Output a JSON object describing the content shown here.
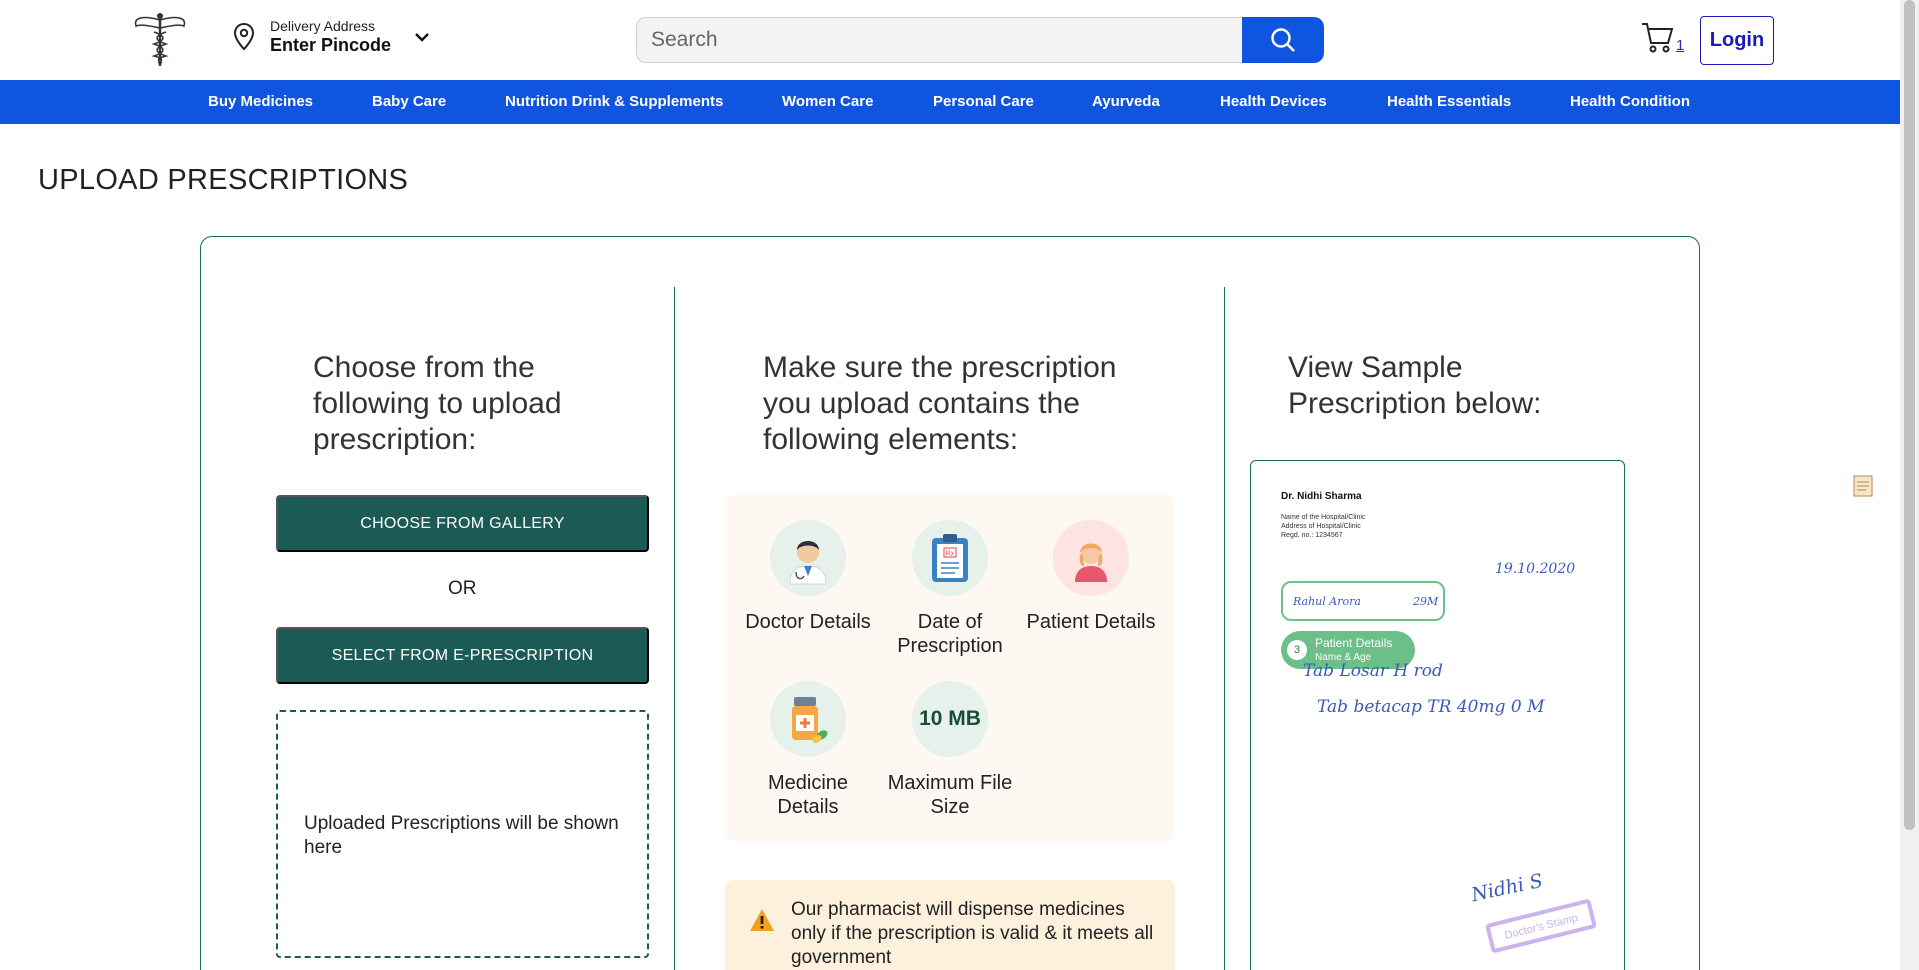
{
  "header": {
    "address_label": "Delivery Address",
    "address_value": "Enter Pincode",
    "search_placeholder": "Search",
    "cart_count": "1",
    "login_label": "Login"
  },
  "nav": {
    "items": [
      "Buy Medicines",
      "Baby Care",
      "Nutrition Drink & Supplements",
      "Women Care",
      "Personal Care",
      "Ayurveda",
      "Health Devices",
      "Health Essentials",
      "Health Condition"
    ]
  },
  "page": {
    "title": "UPLOAD PRESCRIPTIONS"
  },
  "upload": {
    "heading": "Choose from the following to upload prescription:",
    "gallery_button": "CHOOSE FROM GALLERY",
    "or_text": "OR",
    "eprescription_button": "SELECT FROM E-PRESCRIPTION",
    "dropzone_text": "Uploaded Prescriptions will be shown here"
  },
  "requirements": {
    "heading": "Make sure the prescription you upload contains the following elements:",
    "items": [
      {
        "label": "Doctor Details",
        "icon": "doctor-icon"
      },
      {
        "label": "Date of Prescription",
        "icon": "clipboard-rx-icon"
      },
      {
        "label": "Patient Details",
        "icon": "patient-icon"
      },
      {
        "label": "Medicine Details",
        "icon": "medicine-icon"
      },
      {
        "label": "Maximum File Size",
        "badge": "10 MB"
      }
    ],
    "warning": "Our pharmacist will dispense medicines only if the prescription is valid & it meets all government"
  },
  "sample": {
    "heading": "View Sample Prescription below:",
    "doctor_name": "Dr. Nidhi Sharma",
    "hospital_name": "Name of the Hospital/Clinic",
    "hospital_address": "Address of Hospital/Clinic",
    "reg_no": "Regd. no.: 1234567",
    "date_handwritten": "19.10.2020",
    "patient_handwritten": "Rahul Arora",
    "age_handwritten": "29M",
    "rx_line1": "Tab Losar H rod",
    "rx_line2": "Tab betacap TR 40mg 0 M",
    "tag_number": "3",
    "tag_title": "Patient Details",
    "tag_subtitle": "Name & Age",
    "signature": "Nidhi S",
    "stamp_text": "Doctor's Stamp"
  },
  "colors": {
    "primary_blue": "#1055e0",
    "teal": "#1b5a55",
    "border_green": "#1b6b5a"
  }
}
